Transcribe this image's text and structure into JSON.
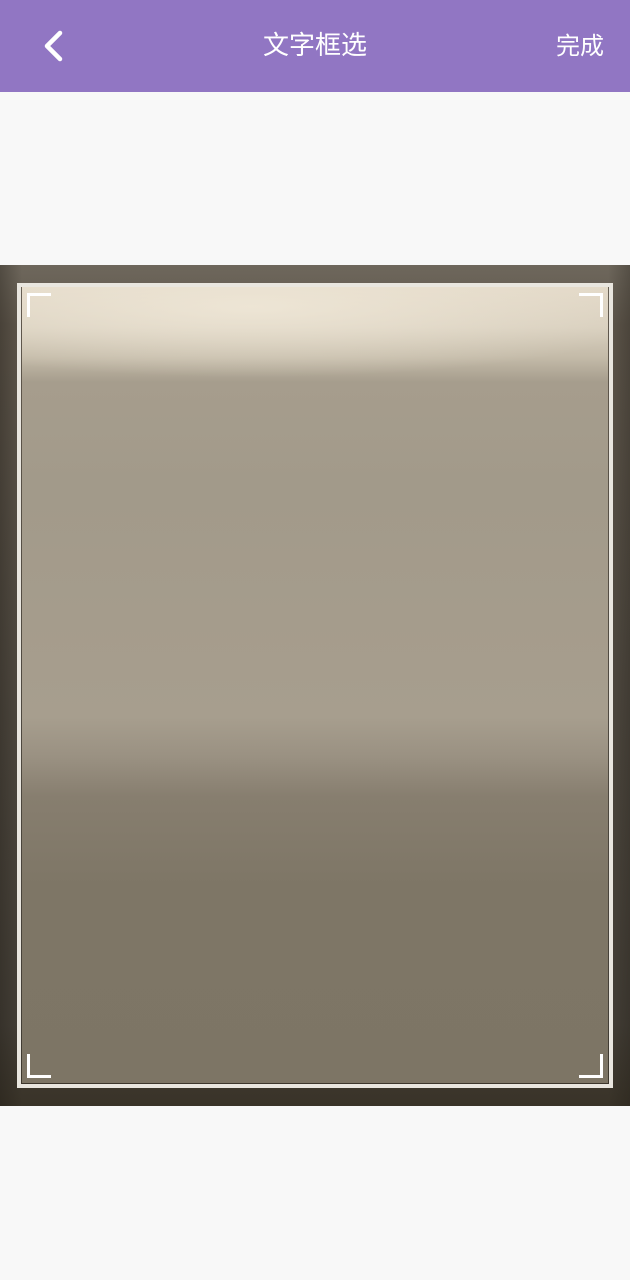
{
  "header": {
    "title": "文字框选",
    "done_label": "完成",
    "back_icon": "chevron-left-icon",
    "background_color": "#9176c3"
  },
  "crop": {
    "handle_icons": [
      "corner-top-left-icon",
      "corner-top-right-icon",
      "corner-bottom-left-icon",
      "corner-bottom-right-icon"
    ],
    "frame_color": "#e9e6df"
  }
}
